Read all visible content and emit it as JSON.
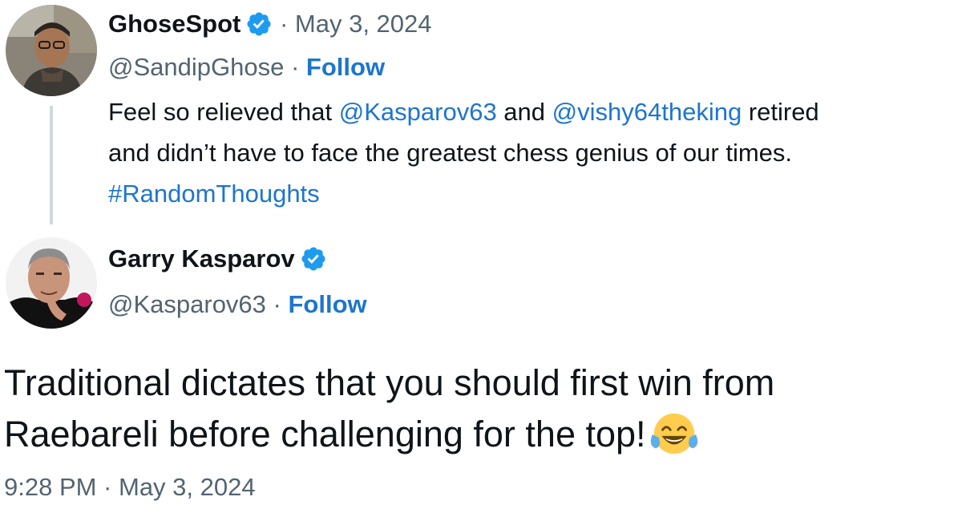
{
  "reply_tweet": {
    "author": {
      "display_name": "GhoseSpot",
      "handle": "@SandipGhose",
      "verified": true,
      "avatar_icon": "user-avatar-ghose"
    },
    "separator": " · ",
    "date": "May 3, 2024",
    "follow_label": "Follow",
    "text": {
      "line1_prefix": "Feel so relieved that ",
      "mention1": "@Kasparov63",
      "line1_mid": " and ",
      "mention2": "@vishy64theking",
      "line1_suffix": " retired",
      "line2": "and didn’t have to face the greatest chess genius of our times.",
      "hashtag": "#RandomThoughts"
    }
  },
  "main_tweet": {
    "author": {
      "display_name": "Garry Kasparov",
      "handle": "@Kasparov63",
      "verified": true,
      "avatar_icon": "user-avatar-kasparov"
    },
    "separator": " · ",
    "follow_label": "Follow",
    "text": {
      "line1": "Traditional dictates that you should first win from",
      "line2": "Raebareli before challenging for the top!",
      "emoji": "face-with-tears-of-joy-icon"
    },
    "timestamp": "9:28 PM · May 3, 2024"
  },
  "colors": {
    "link": "#1d75cf",
    "verified_badge": "#1d9bf0",
    "muted_text": "#536471",
    "thread_line": "#cfd9de"
  }
}
